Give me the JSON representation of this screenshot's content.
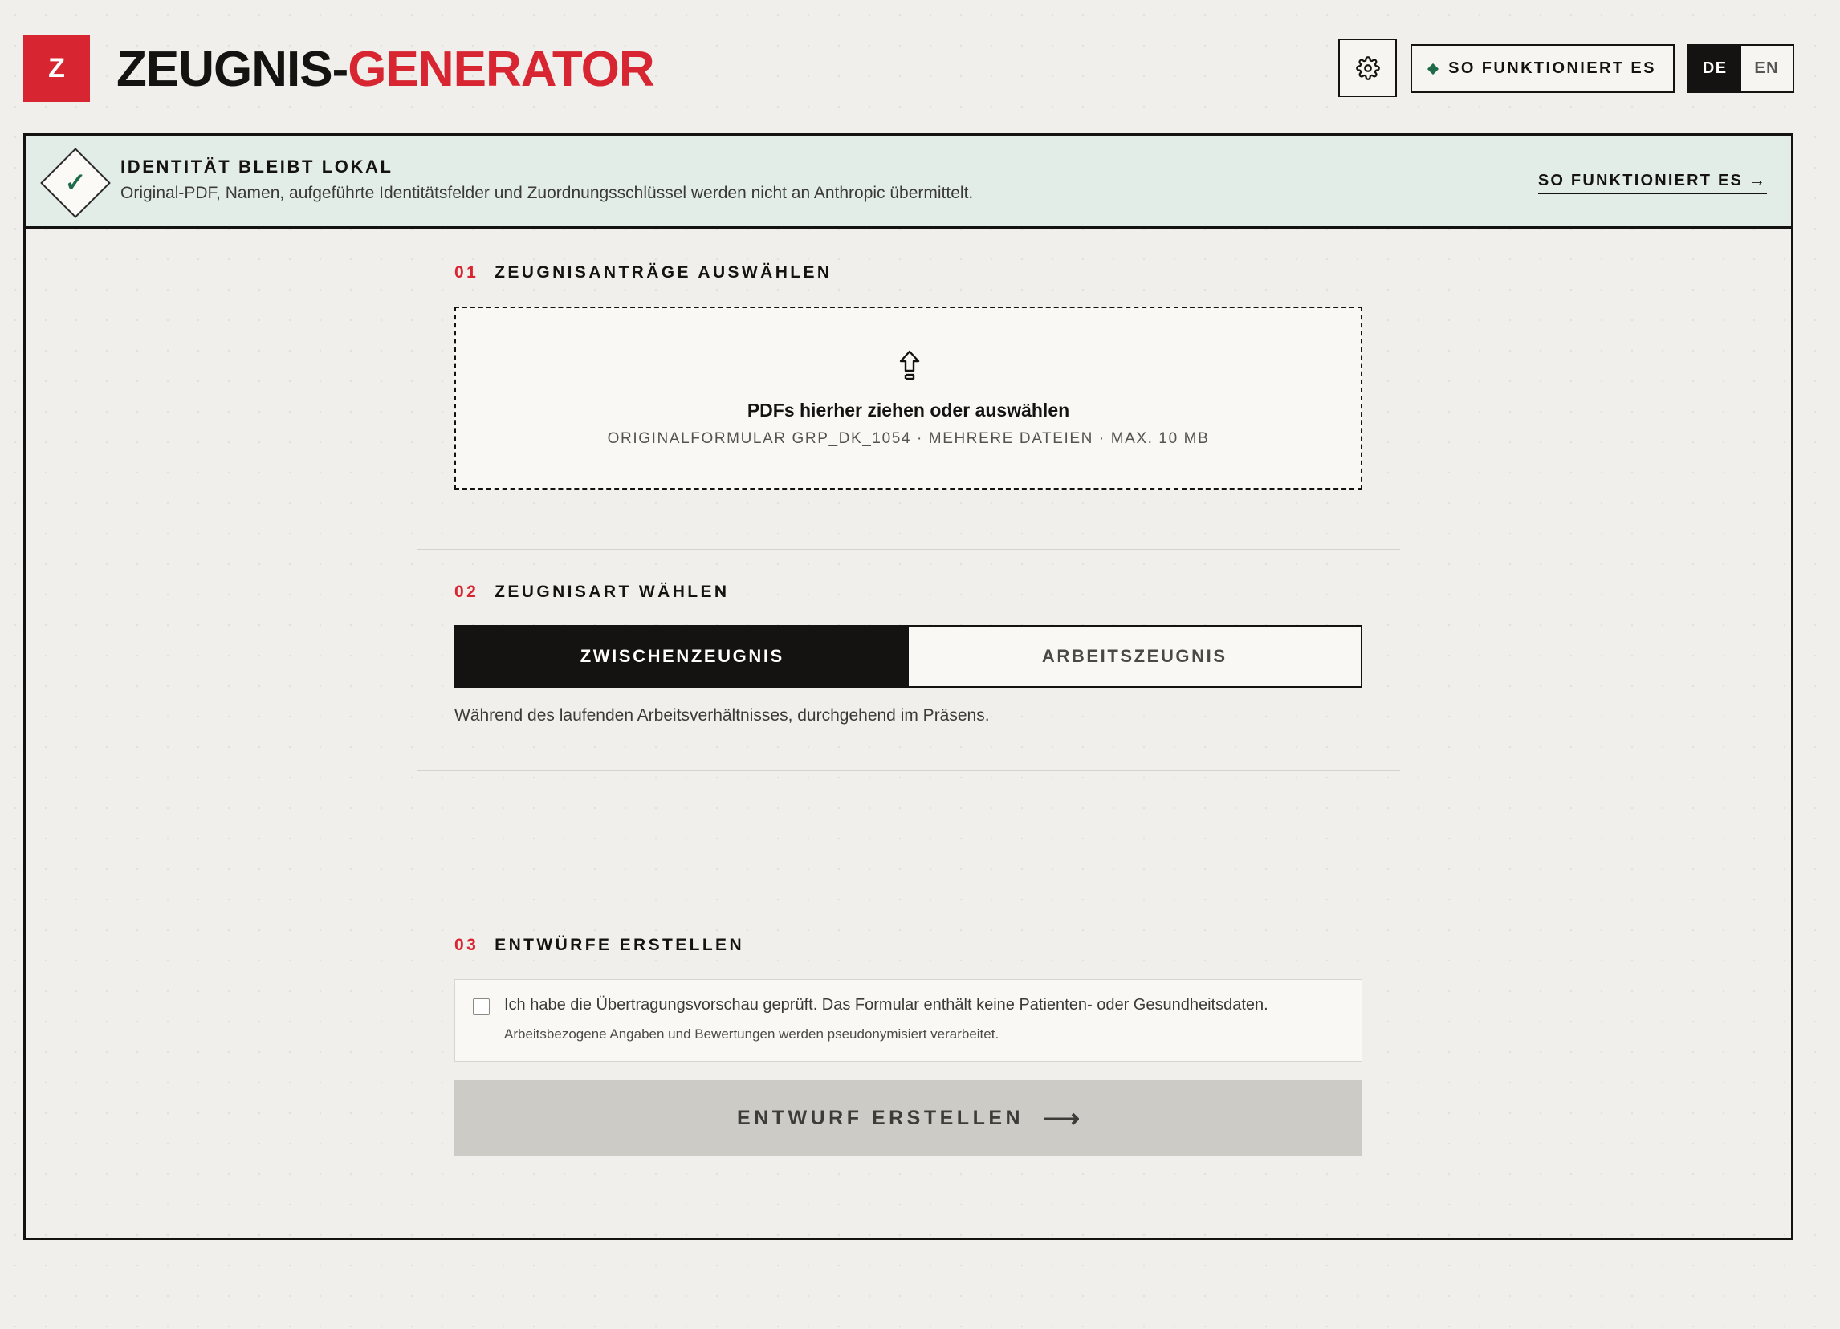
{
  "header": {
    "logo_letter": "Z",
    "title_part1": "ZEUGNIS-",
    "title_part2": "GENERATOR",
    "settings_icon": "gear-icon",
    "how_it_works_label": "SO FUNKTIONIERT ES",
    "languages": [
      "DE",
      "EN"
    ],
    "active_language": "DE"
  },
  "banner": {
    "icon": "check-icon",
    "title": "IDENTITÄT BLEIBT LOKAL",
    "text": "Original-PDF, Namen, aufgeführte Identitätsfelder und Zuordnungsschlüssel werden nicht an Anthropic übermittelt.",
    "link_label": "SO FUNKTIONIERT ES →"
  },
  "step1": {
    "number": "01",
    "title": "ZEUGNISANTRÄGE AUSWÄHLEN",
    "upload_icon": "upload-arrow-icon",
    "drop_main": "PDFs hierher ziehen oder auswählen",
    "drop_sub": "ORIGINALFORMULAR GRP_DK_1054 · MEHRERE DATEIEN · MAX. 10 MB"
  },
  "step2": {
    "number": "02",
    "title": "ZEUGNISART WÄHLEN",
    "options": [
      "ZWISCHENZEUGNIS",
      "ARBEITSZEUGNIS"
    ],
    "selected": "ZWISCHENZEUGNIS",
    "description": "Während des laufenden Arbeitsverhältnisses, durchgehend im Präsens."
  },
  "step3": {
    "number": "03",
    "title": "ENTWÜRFE ERSTELLEN",
    "confirm_text": "Ich habe die Übertragungsvorschau geprüft. Das Formular enthält keine Patienten- oder Gesundheitsdaten.",
    "confirm_sub": "Arbeitsbezogene Angaben und Bewertungen werden pseudonymisiert verarbeitet.",
    "checked": false,
    "button_label": "ENTWURF ERSTELLEN",
    "button_arrow": "⟶"
  },
  "colors": {
    "brand_red": "#d72631",
    "ink": "#141312",
    "banner_bg": "#e3ede8",
    "accent_green": "#1e6b4a",
    "disabled_button": "#cdcbc5"
  }
}
